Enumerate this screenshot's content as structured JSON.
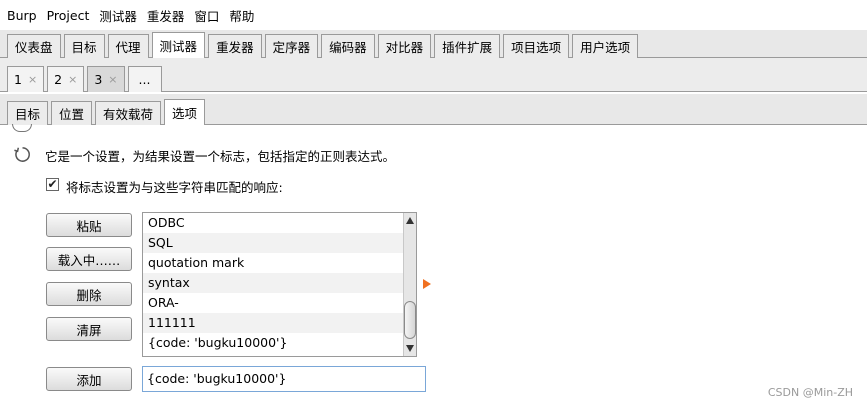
{
  "menu": [
    "Burp",
    "Project",
    "测试器",
    "重发器",
    "窗口",
    "帮助"
  ],
  "top_tabs": {
    "items": [
      "仪表盘",
      "目标",
      "代理",
      "测试器",
      "重发器",
      "定序器",
      "编码器",
      "对比器",
      "插件扩展",
      "项目选项",
      "用户选项"
    ],
    "active": "测试器"
  },
  "attack_tabs": {
    "items": [
      {
        "label": "1",
        "close": "×"
      },
      {
        "label": "2",
        "close": "×"
      },
      {
        "label": "3",
        "close": "×"
      },
      {
        "label": "...",
        "close": ""
      }
    ],
    "active": "3"
  },
  "option_tabs": {
    "items": [
      "目标",
      "位置",
      "有效载荷",
      "选项"
    ],
    "active": "选项"
  },
  "grep": {
    "description": "它是一个设置，为结果设置一个标志，包括指定的正则表达式。",
    "checkbox_label": "将标志设置为与这些字符串匹配的响应:",
    "checkbox_checked": true,
    "checkbox_mark": "✔",
    "buttons": {
      "paste": "粘贴",
      "load": "载入中……",
      "remove": "删除",
      "clear": "清屏",
      "add": "添加"
    },
    "items": [
      "ODBC",
      "SQL",
      "quotation mark",
      "syntax",
      "ORA-",
      "111111",
      "{code: 'bugku10000'}"
    ],
    "add_value": "{code: 'bugku10000'}"
  },
  "watermark": "CSDN @Min-ZH",
  "colors": {
    "marker": "#f07020",
    "input_border": "#7aa7d8"
  }
}
